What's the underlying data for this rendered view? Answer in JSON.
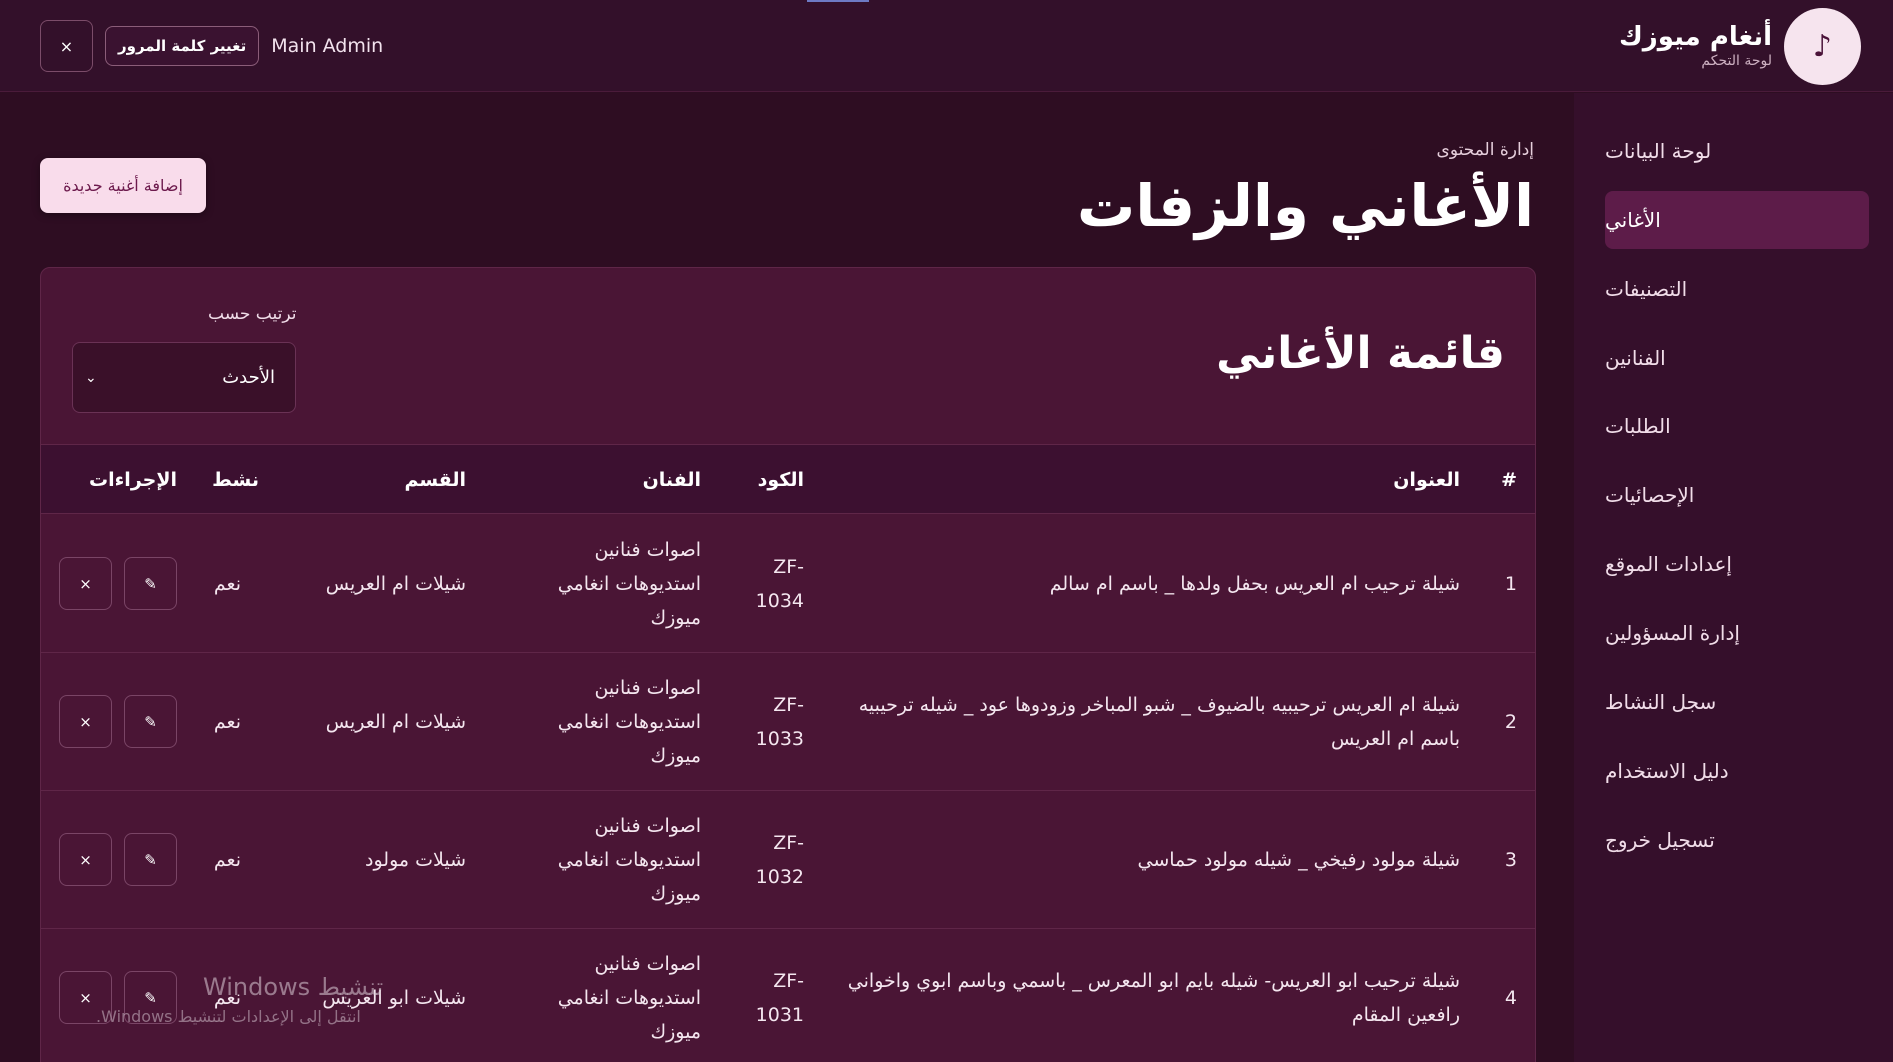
{
  "brand": {
    "name": "أنغام ميوزك",
    "subtitle": "لوحة التحكم",
    "logo_icon": "♪"
  },
  "topbar": {
    "close_label": "×",
    "change_password_label": "تغيير كلمة المرور",
    "admin_name": "Main Admin"
  },
  "sidebar": {
    "items": [
      {
        "label": "لوحة البيانات",
        "active": false
      },
      {
        "label": "الأغاني",
        "active": true
      },
      {
        "label": "التصنيفات",
        "active": false
      },
      {
        "label": "الفنانين",
        "active": false
      },
      {
        "label": "الطلبات",
        "active": false
      },
      {
        "label": "الإحصائيات",
        "active": false
      },
      {
        "label": "إعدادات الموقع",
        "active": false
      },
      {
        "label": "إدارة المسؤولين",
        "active": false
      },
      {
        "label": "سجل النشاط",
        "active": false
      },
      {
        "label": "دليل الاستخدام",
        "active": false
      },
      {
        "label": "تسجيل خروج",
        "active": false
      }
    ]
  },
  "main": {
    "breadcrumb": "إدارة المحتوى",
    "title": "الأغاني والزفات",
    "add_button": "إضافة أغنية جديدة"
  },
  "card": {
    "title": "قائمة الأغاني",
    "sort_label": "ترتيب حسب",
    "sort_value": "الأحدث",
    "columns": {
      "index": "#",
      "title": "العنوان",
      "code": "الكود",
      "artist": "الفنان",
      "category": "القسم",
      "active": "نشط",
      "actions": "الإجراءات"
    },
    "rows": [
      {
        "index": "1",
        "title": "شيلة ترحيب ام العريس بحفل ولدها _ باسم ام سالم",
        "code": "ZF-1034",
        "artist": "اصوات فنانين استديوهات انغامي ميوزك",
        "category": "شيلات ام العريس",
        "active": "نعم"
      },
      {
        "index": "2",
        "title": "شيلة ام العريس ترحيبيه بالضيوف _ شبو المباخر وزودوها عود _ شيله ترحيبيه باسم ام العريس",
        "code": "ZF-1033",
        "artist": "اصوات فنانين استديوهات انغامي ميوزك",
        "category": "شيلات ام العريس",
        "active": "نعم"
      },
      {
        "index": "3",
        "title": "شيلة مولود رفيخي _ شيله مولود حماسي",
        "code": "ZF-1032",
        "artist": "اصوات فنانين استديوهات انغامي ميوزك",
        "category": "شيلات مولود",
        "active": "نعم"
      },
      {
        "index": "4",
        "title": "شيلة ترحيب ابو العريس- شيله بايم ابو المعرس _ باسمي وباسم ابوي واخواني رافعين المقام",
        "code": "ZF-1031",
        "artist": "اصوات فنانين استديوهات انغامي ميوزك",
        "category": "شيلات ابو العريس",
        "active": "نعم"
      }
    ],
    "edit_icon": "✎",
    "delete_icon": "×"
  },
  "watermark": {
    "title": "تنشيط Windows",
    "subtitle": "انتقل إلى الإعدادات لتنشيط Windows."
  },
  "colors": {
    "background": "#2e0d22",
    "sidebar": "#350f2b",
    "card": "#4a1535",
    "active_nav": "#5d1c49",
    "accent_button": "#f9dceb"
  }
}
